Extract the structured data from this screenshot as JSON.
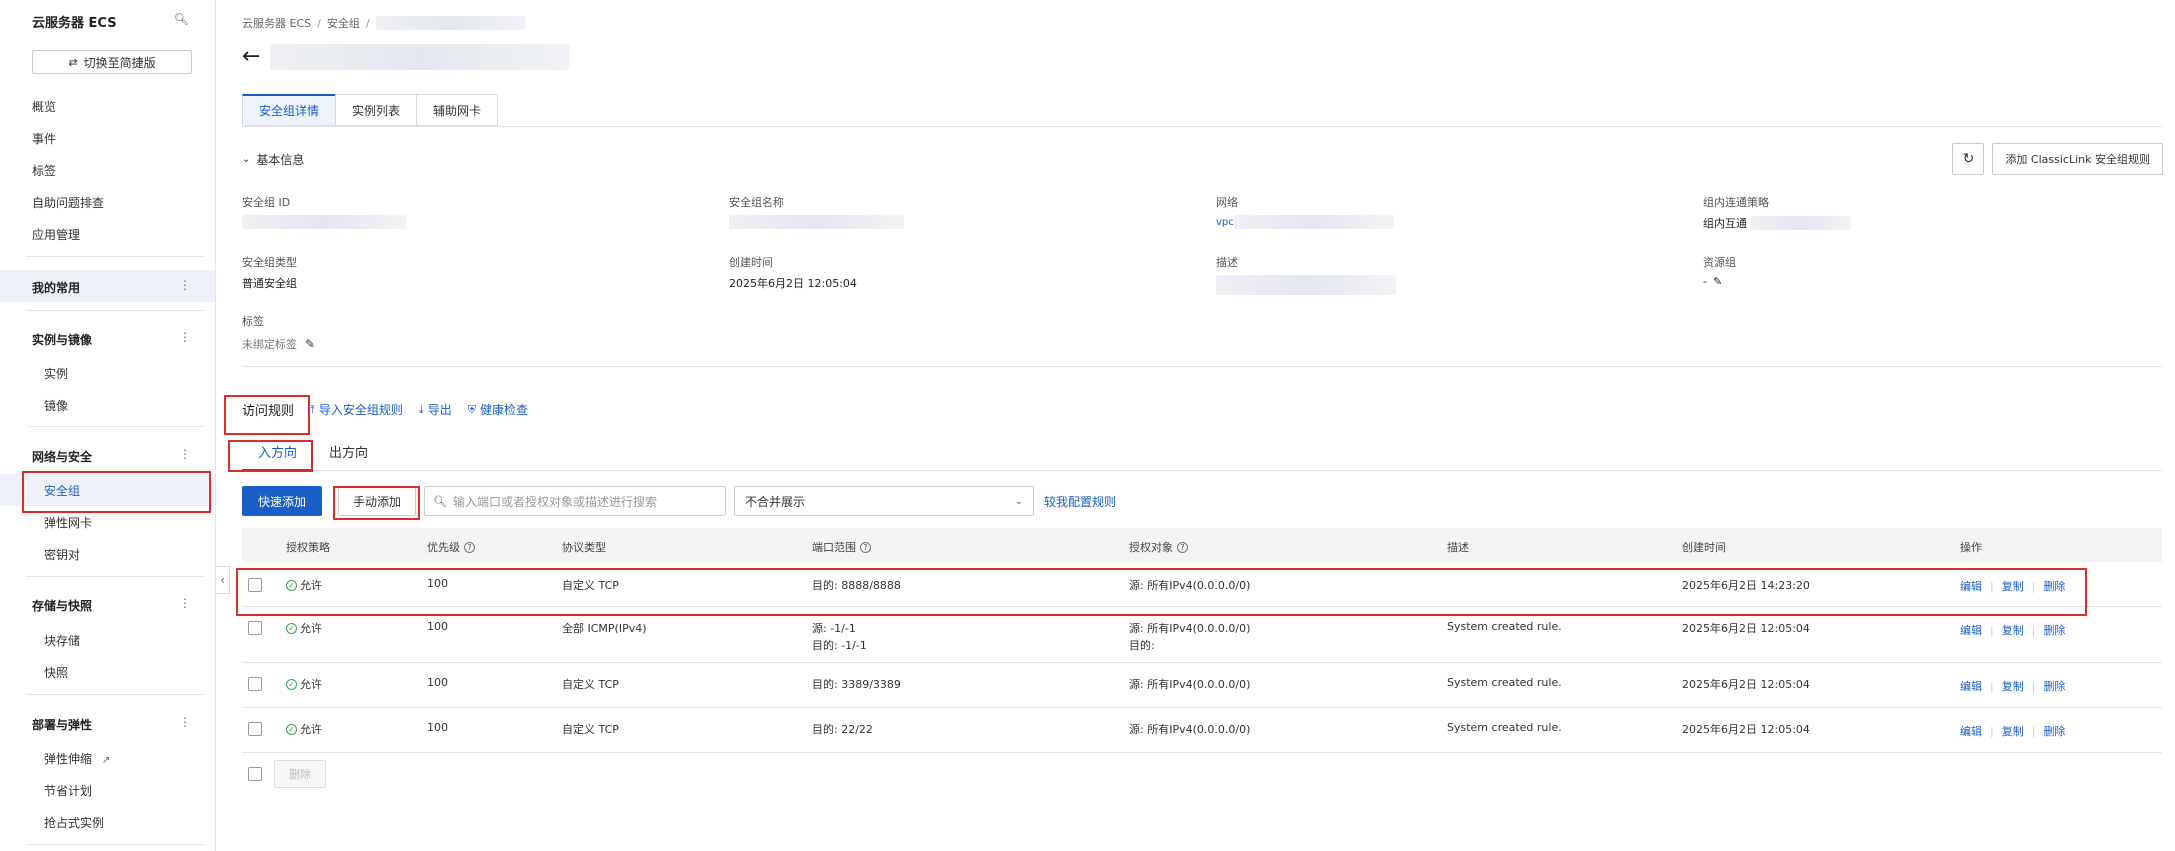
{
  "sidebar": {
    "title": "云服务器 ECS",
    "search_icon": "search-icon",
    "switch_label": "切换至简捷版",
    "items": [
      "概览",
      "事件",
      "标签",
      "自助问题排查",
      "应用管理"
    ],
    "favorites_label": "我的常用",
    "groups": [
      {
        "label": "实例与镜像",
        "items": [
          "实例",
          "镜像"
        ]
      },
      {
        "label": "网络与安全",
        "items": [
          "安全组",
          "弹性网卡",
          "密钥对"
        ]
      },
      {
        "label": "存储与快照",
        "items": [
          "块存储",
          "快照"
        ]
      },
      {
        "label": "部署与弹性",
        "items": [
          "弹性伸缩",
          "节省计划",
          "抢占式实例"
        ]
      }
    ],
    "active_item": "安全组"
  },
  "breadcrumb": {
    "items": [
      "云服务器 ECS",
      "安全组"
    ],
    "sep": "/"
  },
  "tabs": [
    "安全组详情",
    "实例列表",
    "辅助网卡"
  ],
  "basic_info": {
    "header": "基本信息",
    "add_classic_link": "添加 ClassicLink 安全组规则",
    "refresh_icon": "refresh-icon",
    "fields": {
      "sg_id_label": "安全组 ID",
      "sg_name_label": "安全组名称",
      "network_label": "网络",
      "network_val_prefix": "vpc",
      "intra_policy_label": "组内连通策略",
      "intra_policy_value": "组内互通",
      "sg_type_label": "安全组类型",
      "sg_type_value": "普通安全组",
      "created_label": "创建时间",
      "created_value": "2025年6月2日 12:05:04",
      "desc_label": "描述",
      "resource_group_label": "资源组",
      "resource_group_value": "-",
      "tag_label": "标签",
      "tag_value": "未绑定标签"
    }
  },
  "rules": {
    "title": "访问规则",
    "import_label": "导入安全组规则",
    "export_label": "导出",
    "health_label": "健康检查",
    "direction_tabs": [
      "入方向",
      "出方向"
    ],
    "quick_add": "快速添加",
    "manual_add": "手动添加",
    "search_placeholder": "输入端口或者授权对象或描述进行搜索",
    "merge_select": "不合并展示",
    "compare_link": "较我配置规则",
    "columns": [
      "授权策略",
      "优先级",
      "协议类型",
      "端口范围",
      "授权对象",
      "描述",
      "创建时间",
      "操作"
    ],
    "rows": [
      {
        "policy": "允许",
        "priority": "100",
        "protocol": "自定义 TCP",
        "port": [
          "目的: 8888/8888"
        ],
        "auth": [
          "源: 所有IPv4(0.0.0.0/0)"
        ],
        "desc": "",
        "created": "2025年6月2日 14:23:20"
      },
      {
        "policy": "允许",
        "priority": "100",
        "protocol": "全部 ICMP(IPv4)",
        "port": [
          "源: -1/-1",
          "目的: -1/-1"
        ],
        "auth": [
          "源: 所有IPv4(0.0.0.0/0)",
          "目的:"
        ],
        "desc": "System created rule.",
        "created": "2025年6月2日 12:05:04"
      },
      {
        "policy": "允许",
        "priority": "100",
        "protocol": "自定义 TCP",
        "port": [
          "目的: 3389/3389"
        ],
        "auth": [
          "源: 所有IPv4(0.0.0.0/0)"
        ],
        "desc": "System created rule.",
        "created": "2025年6月2日 12:05:04"
      },
      {
        "policy": "允许",
        "priority": "100",
        "protocol": "自定义 TCP",
        "port": [
          "目的: 22/22"
        ],
        "auth": [
          "源: 所有IPv4(0.0.0.0/0)"
        ],
        "desc": "System created rule.",
        "created": "2025年6月2日 12:05:04"
      }
    ],
    "ops": [
      "编辑",
      "复制",
      "删除"
    ],
    "delete_label": "删除"
  },
  "colors": {
    "primary": "#1a5fc7",
    "highlight_box": "#e02b2b",
    "allow": "#3aa34a"
  }
}
